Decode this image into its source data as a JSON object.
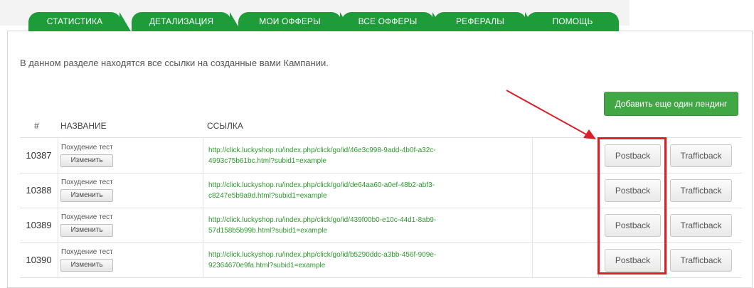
{
  "tabs": [
    {
      "label": "Статистика"
    },
    {
      "label": "Детализация"
    },
    {
      "label": "Мои офферы"
    },
    {
      "label": "Все офферы"
    },
    {
      "label": "Рефералы"
    },
    {
      "label": "Помощь"
    }
  ],
  "intro_text": "В данном разделе находятся все ссылки на созданные вами Кампании.",
  "add_button": "Добавить еще один лендинг",
  "columns": {
    "num": "#",
    "name": "НАЗВАНИЕ",
    "link": "ССЫЛКА"
  },
  "rows": [
    {
      "id": "10387",
      "name": "Похудение тест",
      "edit": "Изменить",
      "link": "http://click.luckyshop.ru/index.php/click/go/id/46e3c998-9add-4b0f-a32c-4993c75b61bc.html?subid1=example",
      "postback": "Postback",
      "trafficback": "Trafficback"
    },
    {
      "id": "10388",
      "name": "Похудение тест",
      "edit": "Изменить",
      "link": "http://click.luckyshop.ru/index.php/click/go/id/de64aa60-a0ef-48b2-abf3-c8247e5b9a9d.html?subid1=example",
      "postback": "Postback",
      "trafficback": "Trafficback"
    },
    {
      "id": "10389",
      "name": "Похудение тест",
      "edit": "Изменить",
      "link": "http://click.luckyshop.ru/index.php/click/go/id/439f00b0-e10c-44d1-8ab9-57d158b5b99b.html?subid1=example",
      "postback": "Postback",
      "trafficback": "Trafficback"
    },
    {
      "id": "10390",
      "name": "Похудение тест",
      "edit": "Изменить",
      "link": "http://click.luckyshop.ru/index.php/click/go/id/b5290ddc-a3bb-456f-909e-92364670e9fa.html?subid1=example",
      "postback": "Postback",
      "trafficback": "Trafficback"
    }
  ],
  "annotation": {
    "color": "#d8202a"
  }
}
